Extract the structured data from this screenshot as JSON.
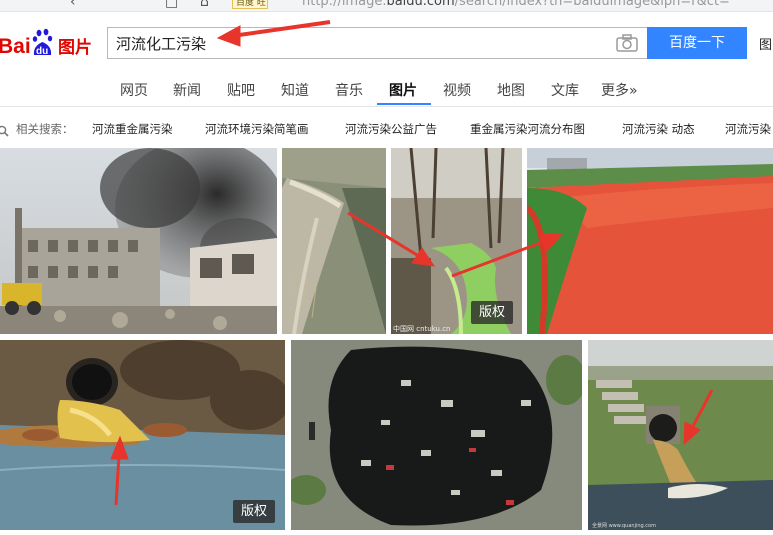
{
  "browser": {
    "badge": "百度 旺",
    "url_prefix": "http://image.",
    "url_domain": "baidu.com",
    "url_rest": "/search/index?tn=baiduimage&ipn=r&ct="
  },
  "header": {
    "logo_text_1": "Bai",
    "logo_text_2": "du",
    "logo_cn": "图片",
    "search_query": "河流化工污染",
    "search_button": "百度一下",
    "top_link": "图"
  },
  "tabs": [
    {
      "label": "网页"
    },
    {
      "label": "新闻"
    },
    {
      "label": "贴吧"
    },
    {
      "label": "知道"
    },
    {
      "label": "音乐"
    },
    {
      "label": "图片"
    },
    {
      "label": "视频"
    },
    {
      "label": "地图"
    },
    {
      "label": "文库"
    },
    {
      "label": "更多»"
    }
  ],
  "related": {
    "label": "相关搜索：",
    "items": [
      "河流重金属污染",
      "河流环境污染简笔画",
      "河流污染公益广告",
      "重金属污染河流分布图",
      "河流污染 动态",
      "河流污染"
    ]
  },
  "images": {
    "copyright_label": "版权",
    "watermark_1": "中国网 cntuku.cn",
    "watermark_2": "全景网 www.quanjing.com"
  },
  "colors": {
    "accent": "#3385ff",
    "logo_red": "#e10601",
    "logo_blue": "#2319dc",
    "arrow_red": "#e8352b"
  }
}
